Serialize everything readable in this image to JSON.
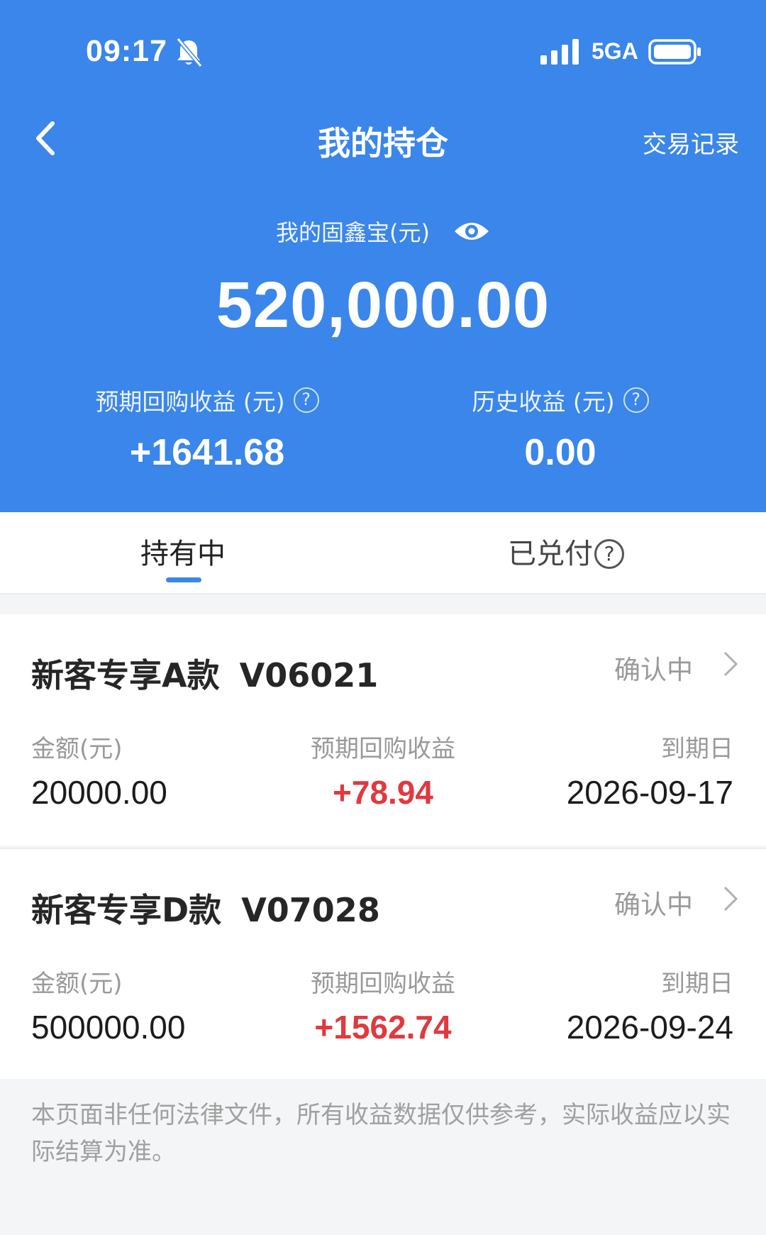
{
  "status_bar": {
    "time": "09:17",
    "network": "5GA"
  },
  "nav": {
    "title": "我的持仓",
    "right_link": "交易记录"
  },
  "summary": {
    "asset_label": "我的固鑫宝(元)",
    "asset_total": "520,000.00",
    "expected_label": "预期回购收益 (元)",
    "expected_value": "+1641.68",
    "history_label": "历史收益 (元)",
    "history_value": "0.00",
    "help_glyph": "?"
  },
  "tabs": [
    {
      "label": "持有中",
      "active": true
    },
    {
      "label": "已兑付",
      "active": false
    }
  ],
  "holdings": [
    {
      "name": "新客专享A款",
      "code": "V06021",
      "status": "确认中",
      "amount_label": "金额(元)",
      "amount": "20000.00",
      "earnings_label": "预期回购收益",
      "earnings": "+78.94",
      "maturity_label": "到期日",
      "maturity": "2026-09-17"
    },
    {
      "name": "新客专享D款",
      "code": "V07028",
      "status": "确认中",
      "amount_label": "金额(元)",
      "amount": "500000.00",
      "earnings_label": "预期回购收益",
      "earnings": "+1562.74",
      "maturity_label": "到期日",
      "maturity": "2026-09-24"
    }
  ],
  "disclaimer": "本页面非任何法律文件，所有收益数据仅供参考，实际收益应以实际结算为准。",
  "colors": {
    "header_bg": "#3a86ea",
    "earnings_red": "#e0393e",
    "tab_indicator": "#3a86ea",
    "page_bg": "#f4f5f7"
  },
  "icons": {
    "bell": "bell-muted-icon",
    "signal": "cellular-signal-icon",
    "battery": "battery-icon",
    "back": "chevron-left-icon",
    "eye": "eye-icon",
    "help": "question-circle-icon",
    "row_arrow": "chevron-right-icon"
  }
}
